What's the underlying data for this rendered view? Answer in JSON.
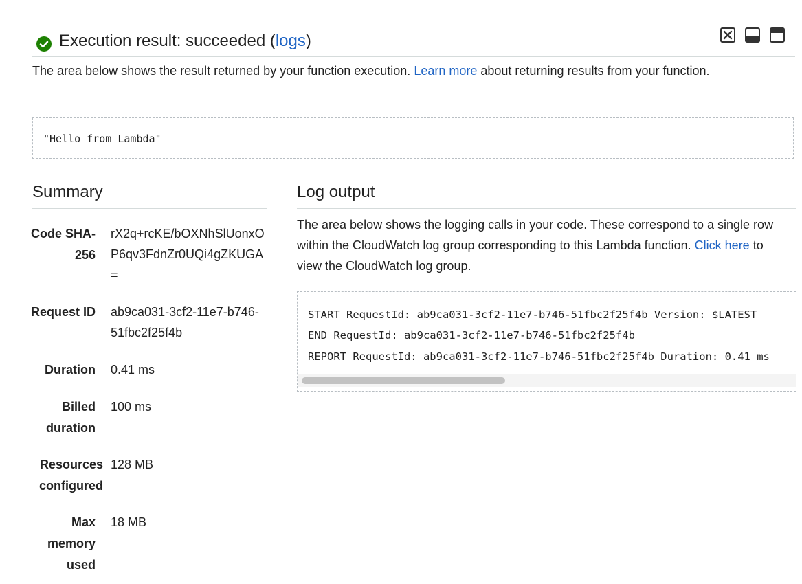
{
  "header": {
    "title": "Execution result: succeeded (",
    "logs_link": "logs",
    "title_suffix": ")"
  },
  "description": {
    "before_link": "The area below shows the result returned by your function execution. ",
    "link": "Learn more",
    "after_link": " about returning results from your function."
  },
  "result": "\"Hello from Lambda\"",
  "summary": {
    "title": "Summary",
    "rows": [
      {
        "label": "Code SHA-256",
        "value": "rX2q+rcKE/bOXNhSlUonxOP6qv3FdnZr0UQi4gZKUGA="
      },
      {
        "label": "Request ID",
        "value": "ab9ca031-3cf2-11e7-b746-51fbc2f25f4b"
      },
      {
        "label": "Duration",
        "value": "0.41 ms"
      },
      {
        "label": "Billed duration",
        "value": "100 ms"
      },
      {
        "label": "Resources configured",
        "value": "128 MB"
      },
      {
        "label": "Max memory used",
        "value": "18 MB"
      }
    ]
  },
  "log_output": {
    "title": "Log output",
    "desc_before_link": "The area below shows the logging calls in your code. These correspond to a single row within the CloudWatch log group corresponding to this Lambda function. ",
    "desc_link": "Click here",
    "desc_after_link": " to view the CloudWatch log group.",
    "lines": [
      "START RequestId: ab9ca031-3cf2-11e7-b746-51fbc2f25f4b Version: $LATEST",
      "END RequestId: ab9ca031-3cf2-11e7-b746-51fbc2f25f4b",
      "REPORT RequestId: ab9ca031-3cf2-11e7-b746-51fbc2f25f4b  Duration: 0.41 ms"
    ]
  },
  "icons": {
    "status": "check-circle-icon",
    "close": "close-icon",
    "minimize": "minimize-icon",
    "maximize": "maximize-icon"
  },
  "colors": {
    "success": "#1d8102",
    "link": "#1f64c4"
  }
}
